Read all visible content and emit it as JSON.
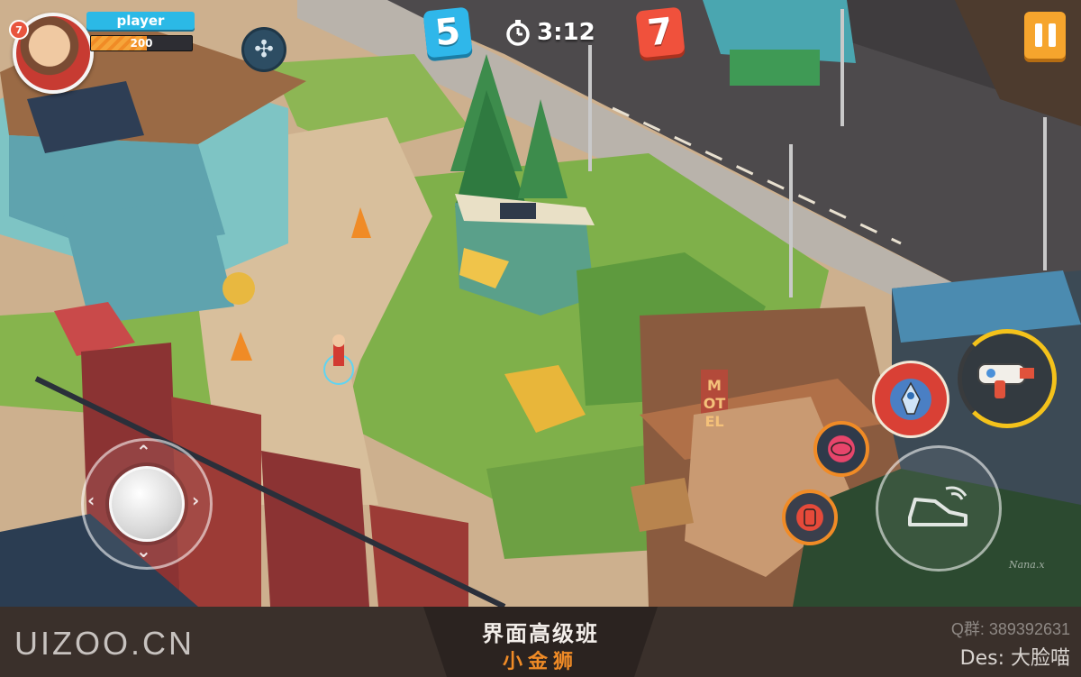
{
  "hud": {
    "player_name": "player",
    "player_level": "7",
    "hp_value": "200",
    "hp_fraction": 0.55,
    "team_blue_score": "5",
    "team_red_score": "7",
    "timer": "3:12",
    "icons": {
      "fan": "fan-icon",
      "timer": "stopwatch-icon",
      "pause": "pause-icon"
    }
  },
  "controls": {
    "joystick_icon": "joystick-icon",
    "weapon_icon": "blaster-icon",
    "rocket_icon": "rocket-icon",
    "mine_icon": "mine-icon",
    "turret_icon": "turret-icon",
    "dash_icon": "sneaker-dash-icon"
  },
  "scene": {
    "motel_sign": "MOTEL",
    "artist_signature": "Nana.x"
  },
  "footer": {
    "brand": "UIZOO.CN",
    "course_title": "界面高级班",
    "course_subtitle": "小金狮",
    "qq": "Q群: 389392631",
    "designer": "Des: 大脸喵"
  },
  "colors": {
    "team_blue": "#2fb7ea",
    "team_red": "#f0513c",
    "accent_orange": "#f6a52d",
    "weapon_ring": "#f4c21b"
  }
}
